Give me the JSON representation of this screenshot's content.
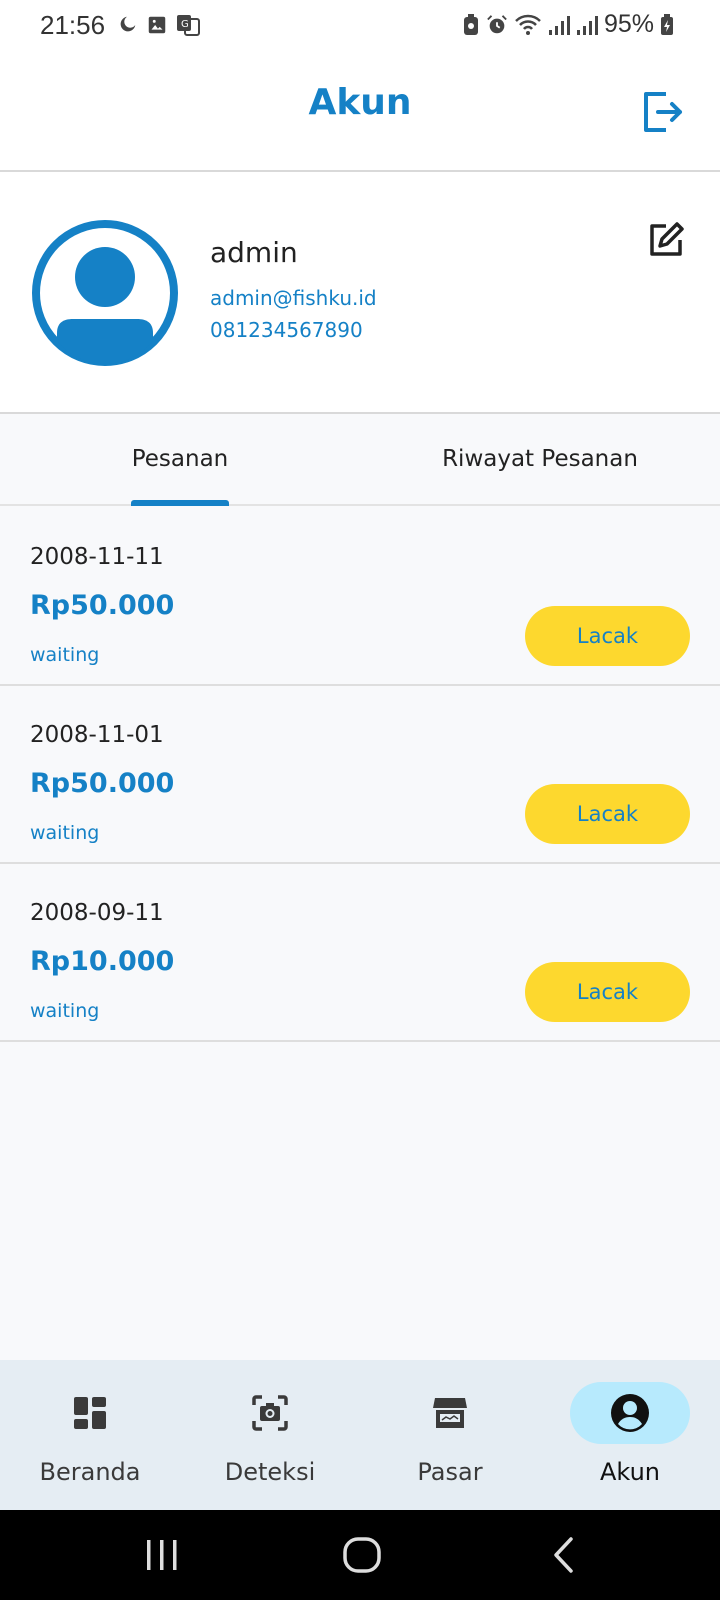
{
  "status_bar": {
    "time": "21:56",
    "battery": "95%"
  },
  "header": {
    "title": "Akun"
  },
  "profile": {
    "name": "admin",
    "email": "admin@fishku.id",
    "phone": "081234567890"
  },
  "tabs": [
    {
      "label": "Pesanan",
      "active": true
    },
    {
      "label": "Riwayat Pesanan",
      "active": false
    }
  ],
  "orders": [
    {
      "date": "2008-11-11",
      "price": "Rp50.000",
      "status": "waiting",
      "action": "Lacak"
    },
    {
      "date": "2008-11-01",
      "price": "Rp50.000",
      "status": "waiting",
      "action": "Lacak"
    },
    {
      "date": "2008-09-11",
      "price": "Rp10.000",
      "status": "waiting",
      "action": "Lacak"
    }
  ],
  "bottom_nav": [
    {
      "label": "Beranda",
      "icon": "dashboard-icon"
    },
    {
      "label": "Deteksi",
      "icon": "camera-scan-icon"
    },
    {
      "label": "Pasar",
      "icon": "storefront-icon"
    },
    {
      "label": "Akun",
      "icon": "account-circle-icon",
      "active": true
    }
  ],
  "colors": {
    "primary": "#1581c6",
    "accent": "#fdd82e",
    "active_nav_bg": "#b7eafd"
  }
}
